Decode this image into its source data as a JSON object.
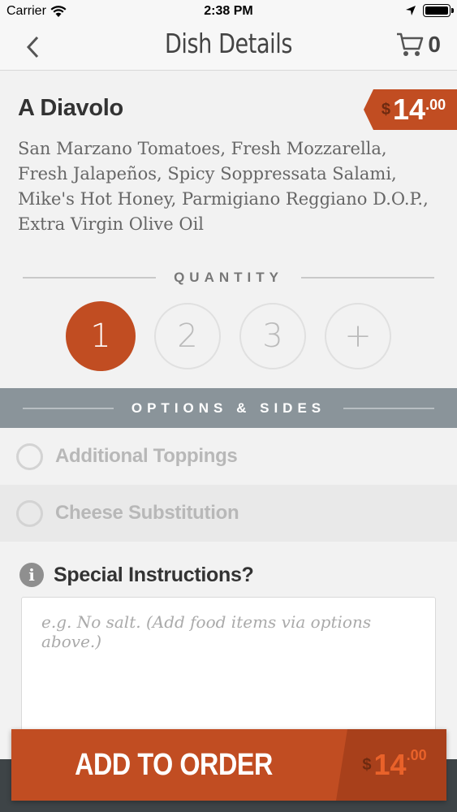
{
  "status_bar": {
    "carrier": "Carrier",
    "time": "2:38 PM"
  },
  "nav": {
    "title": "Dish Details",
    "cart_count": "0"
  },
  "dish": {
    "name": "A Diavolo",
    "price_currency": "$",
    "price_whole": "14",
    "price_cents": ".00",
    "description": "San Marzano Tomatoes, Fresh Mozzarella, Fresh Jalapeños, Spicy Soppressata Salami, Mike's Hot Honey, Parmigiano Reggiano D.O.P., Extra Virgin Olive Oil"
  },
  "quantity": {
    "label": "QUANTITY",
    "options": [
      "1",
      "2",
      "3",
      "+"
    ],
    "selected": "1"
  },
  "options_sides": {
    "label": "OPTIONS & SIDES",
    "items": [
      {
        "label": "Additional Toppings"
      },
      {
        "label": "Cheese Substitution"
      }
    ]
  },
  "special_instructions": {
    "label": "Special Instructions?",
    "placeholder": "e.g. No salt. (Add food items via options above.)",
    "value": ""
  },
  "add_to_order": {
    "label": "ADD TO ORDER",
    "price_currency": "$",
    "price_whole": "14",
    "price_cents": ".00"
  },
  "colors": {
    "accent": "#c14d22",
    "options_bar": "#8a949a",
    "footer": "#3e4447"
  }
}
